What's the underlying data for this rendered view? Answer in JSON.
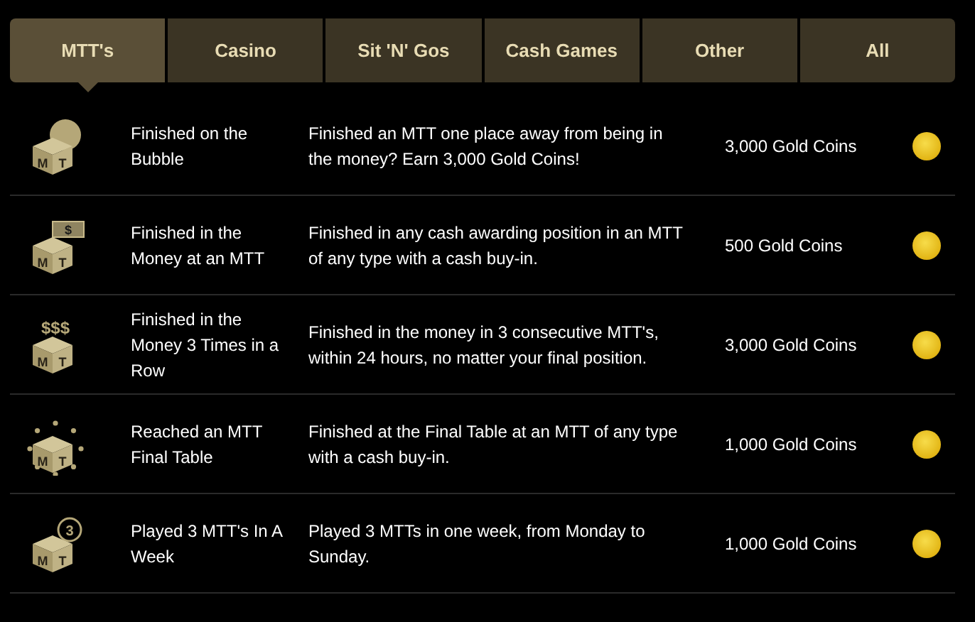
{
  "tabs": [
    {
      "label": "MTT's",
      "selected": true
    },
    {
      "label": "Casino",
      "selected": false
    },
    {
      "label": "Sit 'N' Gos",
      "selected": false
    },
    {
      "label": "Cash Games",
      "selected": false
    },
    {
      "label": "Other",
      "selected": false
    },
    {
      "label": "All",
      "selected": false
    }
  ],
  "achievements": [
    {
      "icon": {
        "kind": "bubble",
        "letters": [
          "M",
          "T"
        ]
      },
      "title": "Finished on the Bubble",
      "description": "Finished an MTT one place away from being in the money? Earn 3,000 Gold Coins!",
      "reward": "3,000 Gold Coins"
    },
    {
      "icon": {
        "kind": "cash",
        "letters": [
          "M",
          "T"
        ],
        "symbol": "$"
      },
      "title": "Finished in the Money at an MTT",
      "description": "Finished in any cash awarding position in an MTT of any type with a cash buy-in.",
      "reward": "500 Gold Coins"
    },
    {
      "icon": {
        "kind": "dollars",
        "letters": [
          "M",
          "T"
        ],
        "symbol": "$$$"
      },
      "title": "Finished in the Money 3 Times in a Row",
      "description": "Finished in the money in 3 consecutive MTT's, within 24 hours, no matter your final position.",
      "reward": "3,000 Gold Coins"
    },
    {
      "icon": {
        "kind": "sparkle",
        "letters": [
          "M",
          "T"
        ]
      },
      "title": "Reached an MTT Final Table",
      "description": "Finished at the Final Table at an MTT of any type with a cash buy-in.",
      "reward": "1,000 Gold Coins"
    },
    {
      "icon": {
        "kind": "badge",
        "letters": [
          "M",
          "T"
        ],
        "symbol": "3"
      },
      "title": "Played 3 MTT's In A Week",
      "description": "Played 3 MTTs in one week, from Monday to Sunday.",
      "reward": "1,000 Gold Coins"
    }
  ]
}
